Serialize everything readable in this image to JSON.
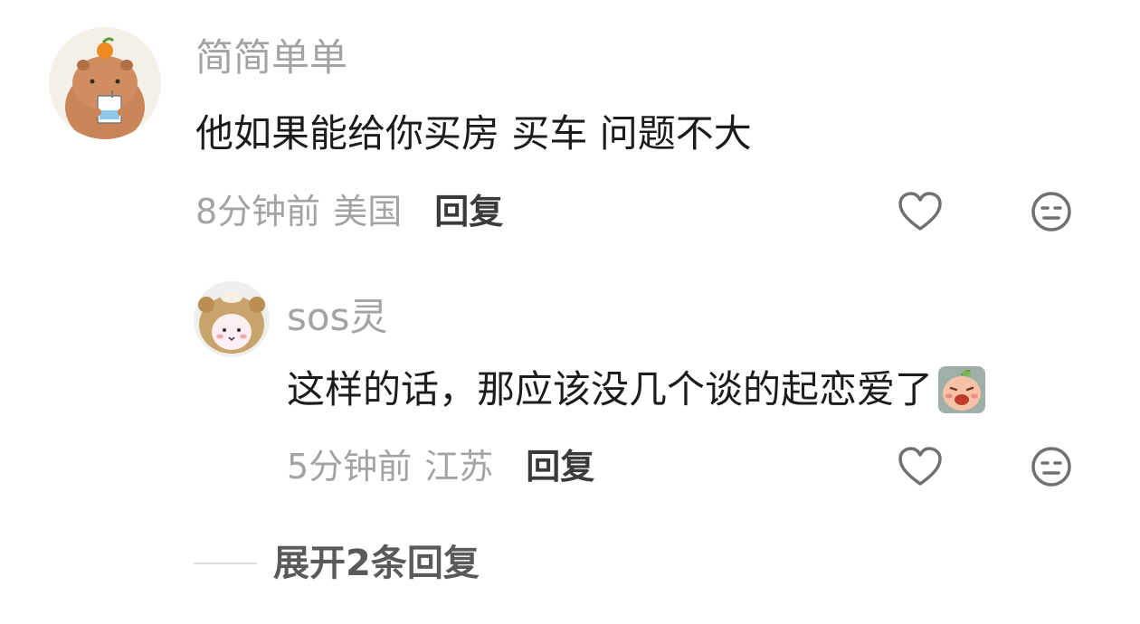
{
  "comments": [
    {
      "username": "简简单单",
      "text": "他如果能给你买房 买车 问题不大",
      "time": "8分钟前",
      "location": "美国",
      "reply_label": "回复",
      "avatar_icon": "capybara-drinking-avatar"
    },
    {
      "username": "sos灵",
      "text": "这样的话，那应该没几个谈的起恋爱了",
      "emoji_icon": "crying-peach-emoji",
      "time": "5分钟前",
      "location": "江苏",
      "reply_label": "回复",
      "avatar_icon": "bear-hood-avatar"
    }
  ],
  "expand_replies": "展开2条回复",
  "colors": {
    "secondary_text": "#a3a3a3",
    "primary_text": "#1c1c1c",
    "icon_stroke": "#707070"
  }
}
